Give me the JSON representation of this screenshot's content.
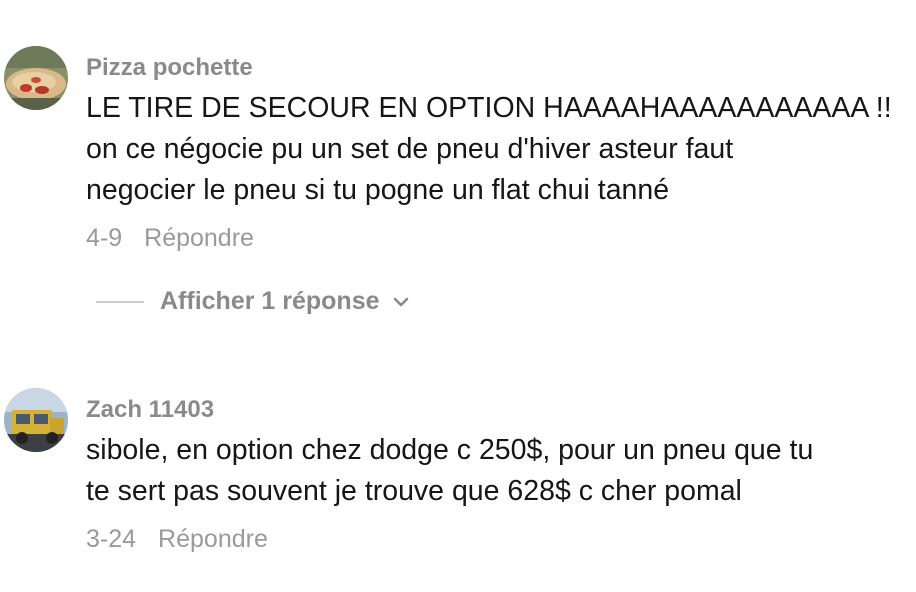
{
  "comments": [
    {
      "username": "Pizza pochette",
      "lines": [
        "LE TIRE DE SECOUR EN OPTION HAAAAHAAAAAAAAAAA !!",
        "on ce négocie pu un set de pneu d'hiver asteur faut",
        "negocier le pneu si tu pogne un flat chui tanné"
      ],
      "date": "4-9",
      "reply_label": "Répondre",
      "view_replies_label": "Afficher 1 réponse"
    },
    {
      "username": "Zach 11403",
      "lines": [
        "sibole, en option chez dodge c 250$, pour un pneu que tu",
        "te sert pas souvent je trouve que 628$ c cher pomal"
      ],
      "date": "3-24",
      "reply_label": "Répondre"
    }
  ],
  "icons": {
    "expand": "chevron-down-icon"
  }
}
